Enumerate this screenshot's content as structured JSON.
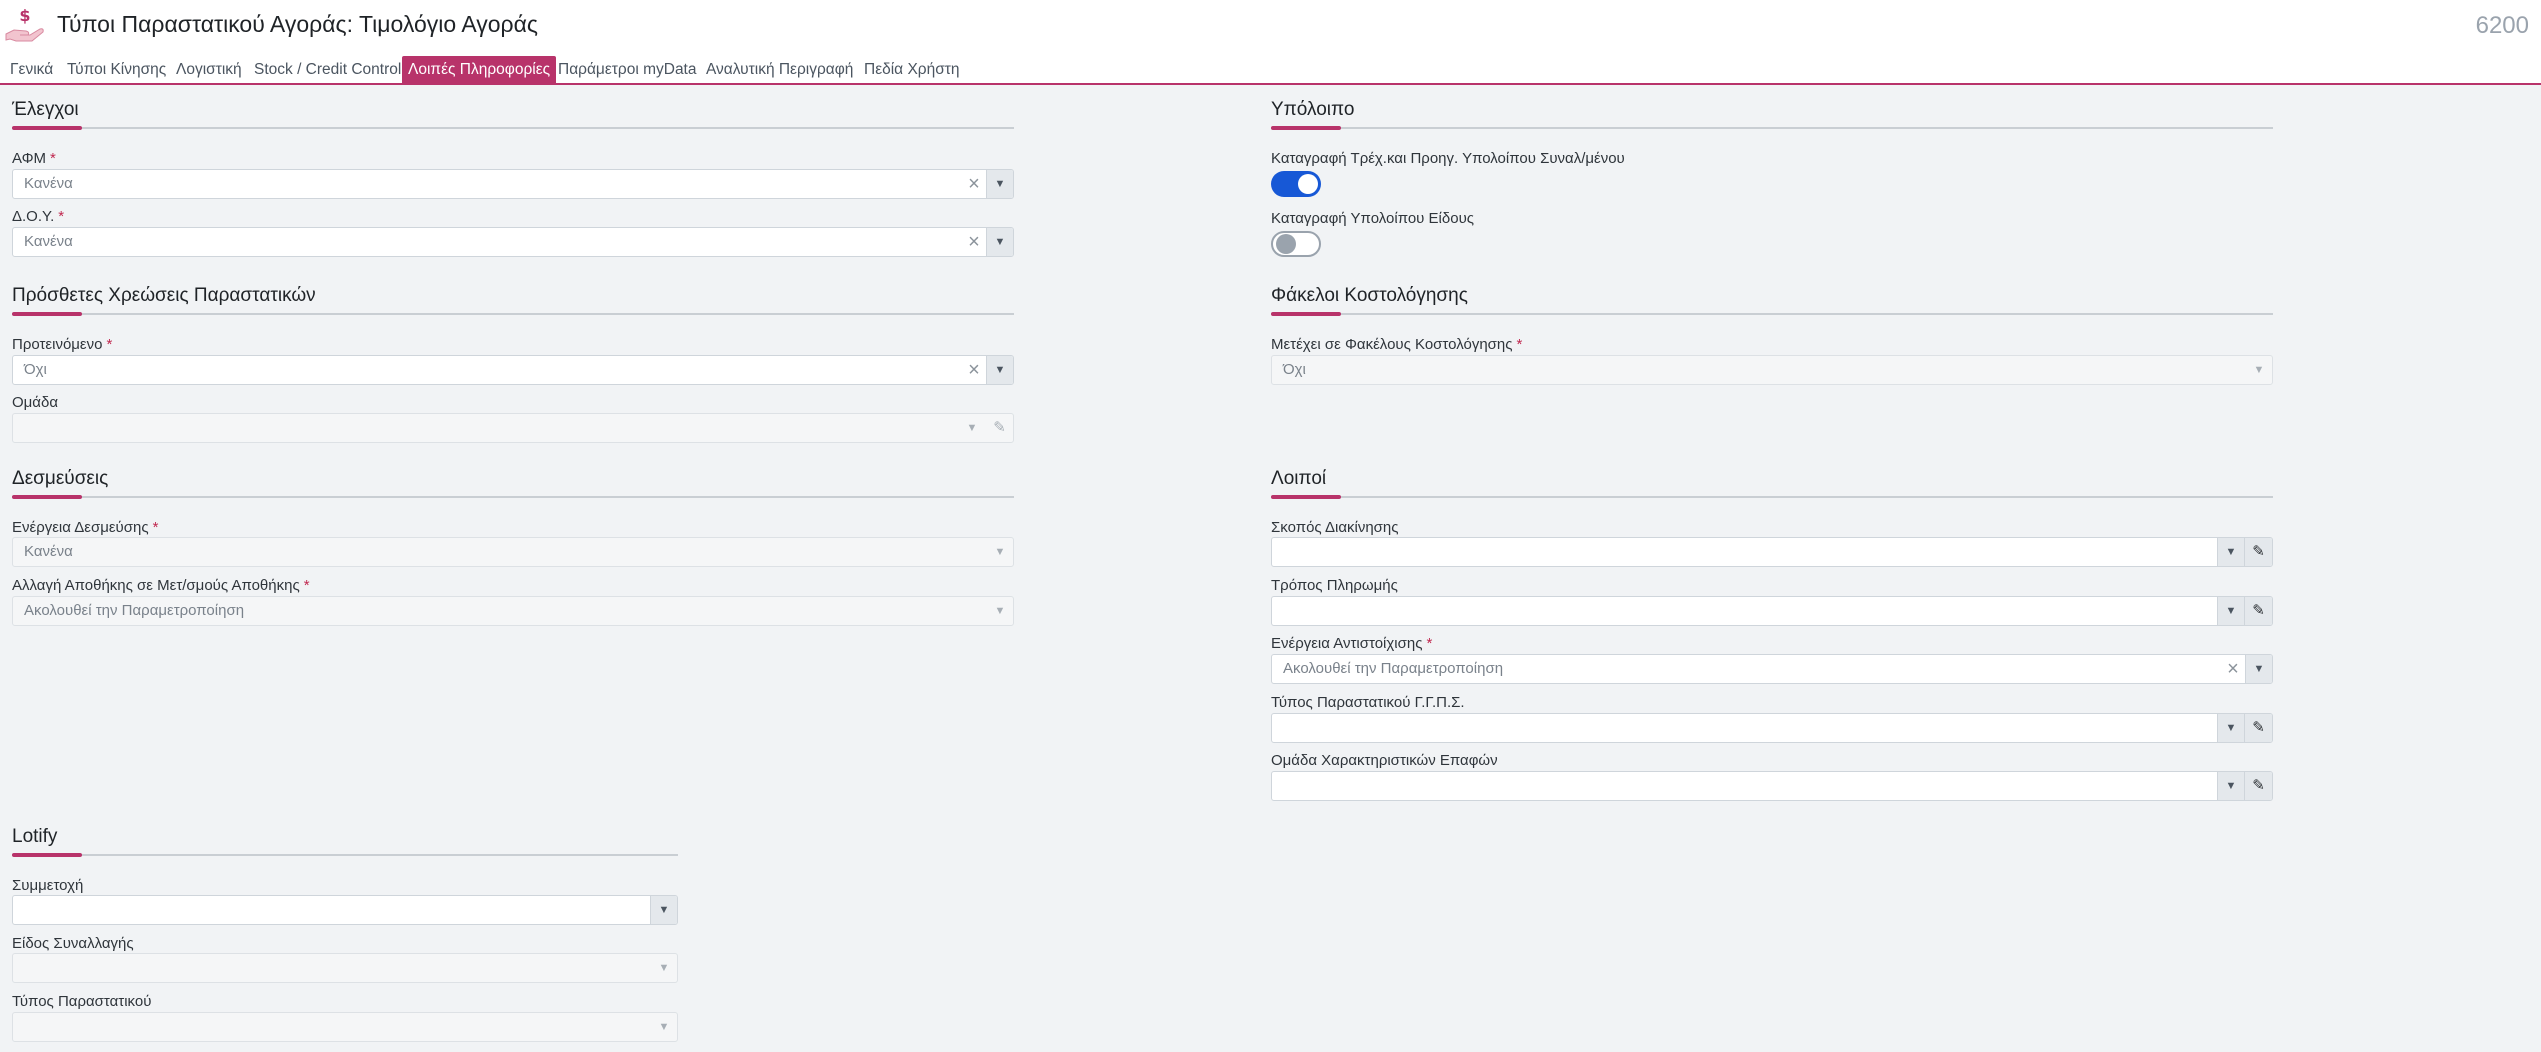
{
  "header": {
    "title": "Τύποι Παραστατικού Αγοράς: Τιμολόγιο Αγοράς",
    "doc_number": "6200",
    "icon": "money-hand-icon"
  },
  "tabs": [
    {
      "label": "Γενικά",
      "active": false
    },
    {
      "label": "Τύποι Κίνησης",
      "active": false
    },
    {
      "label": "Λογιστική",
      "active": false
    },
    {
      "label": "Stock / Credit Control",
      "active": false
    },
    {
      "label": "Λοιπές Πληροφορίες",
      "active": true
    },
    {
      "label": "Παράμετροι myData",
      "active": false
    },
    {
      "label": "Αναλυτική Περιγραφή",
      "active": false
    },
    {
      "label": "Πεδία Χρήστη",
      "active": false
    }
  ],
  "colors": {
    "accent": "#b8336a",
    "toggle_on": "#1758d6",
    "required": "#c0284f"
  },
  "checks": {
    "title": "Έλεγχοι",
    "afm": {
      "label": "ΑΦΜ",
      "required": "*",
      "value": "Κανένα"
    },
    "doy": {
      "label": "Δ.Ο.Υ.",
      "required": "*",
      "value": "Κανένα"
    }
  },
  "extra_charges": {
    "title": "Πρόσθετες Χρεώσεις Παραστατικών",
    "suggested": {
      "label": "Προτεινόμενο",
      "required": "*",
      "value": "Όχι"
    },
    "group": {
      "label": "Ομάδα",
      "value": ""
    }
  },
  "commitments": {
    "title": "Δεσμεύσεις",
    "action": {
      "label": "Ενέργεια Δεσμεύσης",
      "required": "*",
      "value": "Κανένα"
    },
    "warehouse_change": {
      "label": "Αλλαγή Αποθήκης σε Μετ/σμούς Αποθήκης",
      "required": "*",
      "value": "Ακολουθεί την Παραμετροποίηση"
    }
  },
  "balance": {
    "title": "Υπόλοιπο",
    "record_current": {
      "label": "Καταγραφή Τρέχ.και Προηγ. Υπολοίπου Συναλ/μένου",
      "on": true
    },
    "record_item": {
      "label": "Καταγραφή Υπολοίπου Είδους",
      "on": false
    }
  },
  "costing": {
    "title": "Φάκελοι Κοστολόγησης",
    "participates": {
      "label": "Μετέχει σε Φακέλους Κοστολόγησης",
      "required": "*",
      "value": "Όχι"
    }
  },
  "others": {
    "title": "Λοιποί",
    "purpose": {
      "label": "Σκοπός Διακίνησης",
      "value": ""
    },
    "payment": {
      "label": "Τρόπος Πληρωμής",
      "value": ""
    },
    "matching": {
      "label": "Ενέργεια Αντιστοίχισης",
      "required": "*",
      "value": "Ακολουθεί την Παραμετροποίηση"
    },
    "ggps_type": {
      "label": "Τύπος Παραστατικού Γ.Γ.Π.Σ.",
      "value": ""
    },
    "contact_group": {
      "label": "Ομάδα Χαρακτηριστικών Επαφών",
      "value": ""
    }
  },
  "lotify": {
    "title": "Lotify",
    "participation": {
      "label": "Συμμετοχή",
      "value": ""
    },
    "transaction_type": {
      "label": "Είδος Συναλλαγής",
      "value": ""
    },
    "document_type": {
      "label": "Τύπος Παραστατικού",
      "value": ""
    }
  }
}
